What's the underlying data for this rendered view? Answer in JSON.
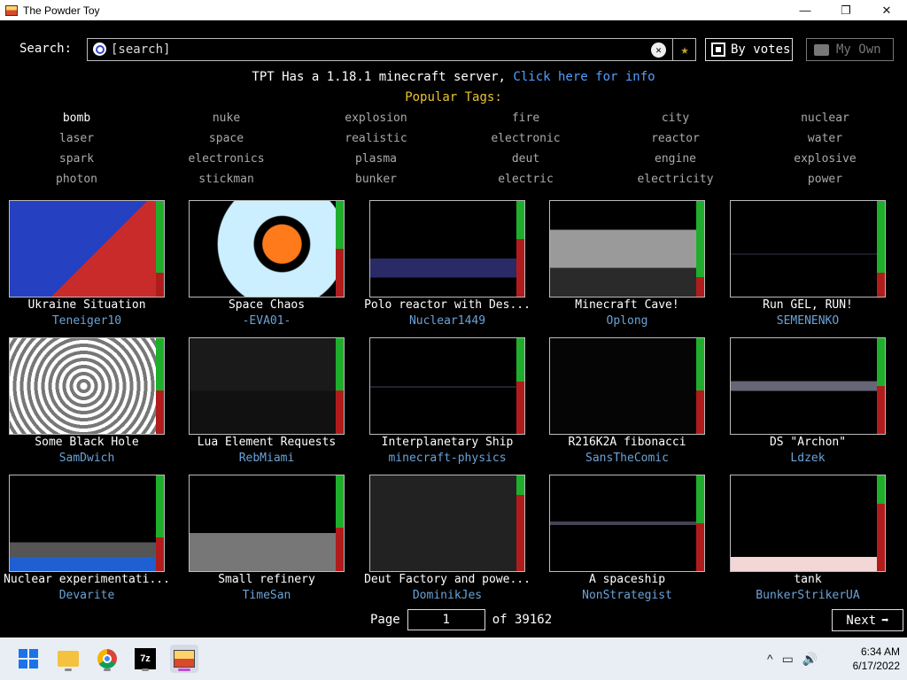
{
  "window": {
    "title": "The Powder Toy",
    "minimize": "—",
    "maximize": "❐",
    "close": "✕"
  },
  "search": {
    "label": "Search:",
    "placeholder": "[search]",
    "clear": "✕",
    "fav": "★"
  },
  "sort_button": "By votes",
  "my_own_button": "My Own",
  "motd": {
    "text": "TPT Has a 1.18.1 minecraft server, ",
    "link": "Click here for info"
  },
  "tags_title": "Popular Tags:",
  "tags": [
    "bomb",
    "nuke",
    "explosion",
    "fire",
    "city",
    "nuclear",
    "laser",
    "space",
    "realistic",
    "electronic",
    "reactor",
    "water",
    "spark",
    "electronics",
    "plasma",
    "deut",
    "engine",
    "explosive",
    "photon",
    "stickman",
    "bunker",
    "electric",
    "electricity",
    "power"
  ],
  "saves": [
    {
      "name": "Ukraine Situation",
      "author": "Teneiger10",
      "votes_up_fraction": 0.75
    },
    {
      "name": "Space Chaos",
      "author": "-EVA01-",
      "votes_up_fraction": 0.5
    },
    {
      "name": "Polo reactor with Des...",
      "author": "Nuclear1449",
      "votes_up_fraction": 0.4
    },
    {
      "name": "Minecraft Cave!",
      "author": "Oplong",
      "votes_up_fraction": 0.8
    },
    {
      "name": "Run GEL, RUN!",
      "author": "SEMENENKO",
      "votes_up_fraction": 0.75
    },
    {
      "name": "Some Black Hole",
      "author": "SamDwich",
      "votes_up_fraction": 0.55
    },
    {
      "name": "Lua Element Requests",
      "author": "RebMiami",
      "votes_up_fraction": 0.55
    },
    {
      "name": "Interplanetary Ship",
      "author": "minecraft-physics",
      "votes_up_fraction": 0.45
    },
    {
      "name": "R216K2A fibonacci",
      "author": "SansTheComic",
      "votes_up_fraction": 0.55
    },
    {
      "name": "DS \"Archon\"",
      "author": "Ldzek",
      "votes_up_fraction": 0.5
    },
    {
      "name": "Nuclear experimentati...",
      "author": "Devarite",
      "votes_up_fraction": 0.65
    },
    {
      "name": "Small refinery",
      "author": "TimeSan",
      "votes_up_fraction": 0.55
    },
    {
      "name": "Deut Factory and powe...",
      "author": "DominikJes",
      "votes_up_fraction": 0.2
    },
    {
      "name": "A spaceship",
      "author": "NonStrategist",
      "votes_up_fraction": 0.5
    },
    {
      "name": "tank",
      "author": "BunkerStrikerUA",
      "votes_up_fraction": 0.3
    }
  ],
  "pager": {
    "page_label": "Page",
    "page_value": "1",
    "of_label": "of 39162",
    "next": "Next"
  },
  "taskbar": {
    "icons": [
      "windows-start-icon",
      "file-explorer-icon",
      "chrome-icon",
      "7zip-icon",
      "powder-toy-icon"
    ],
    "sevenz_label": "7z",
    "tray": {
      "chevron": "^",
      "network": "▭",
      "volume": "🔊"
    },
    "time": "6:34 AM",
    "date": "6/17/2022"
  }
}
